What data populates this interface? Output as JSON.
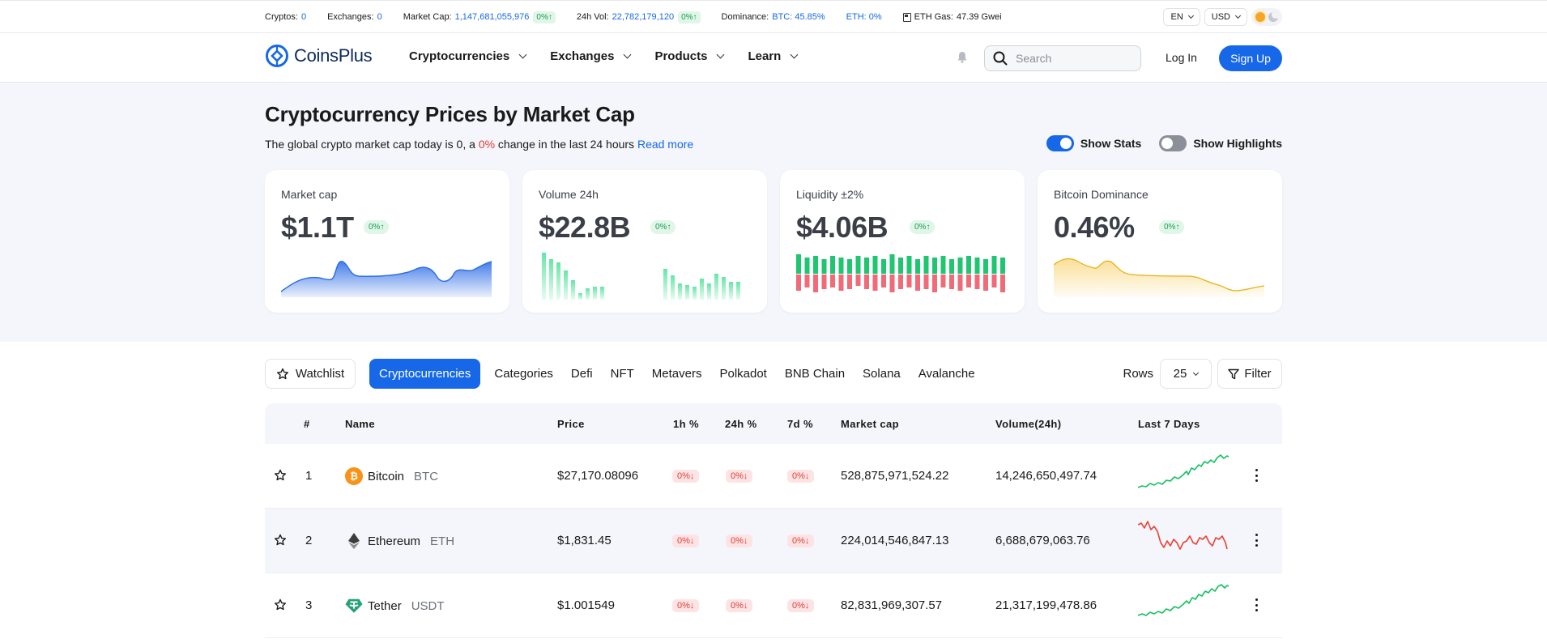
{
  "ticker": {
    "cryptos_label": "Cryptos:",
    "cryptos_value": "0",
    "exchanges_label": "Exchanges:",
    "exchanges_value": "0",
    "marketcap_label": "Market Cap:",
    "marketcap_value": "1,147,681,055,976",
    "marketcap_change": "0%",
    "vol_label": "24h Vol:",
    "vol_value": "22,782,179,120",
    "vol_change": "0%",
    "dominance_label": "Dominance:",
    "dominance_btc": "BTC: 45.85%",
    "dominance_eth": "ETH: 0%",
    "gas_label": "ETH Gas:",
    "gas_value": "47.39 Gwei",
    "language": "EN",
    "currency": "USD"
  },
  "header": {
    "logo_text": "CoinsPlus",
    "nav": [
      "Cryptocurrencies",
      "Exchanges",
      "Products",
      "Learn"
    ],
    "search_placeholder": "Search",
    "login_label": "Log In",
    "signup_label": "Sign Up"
  },
  "hero": {
    "title": "Cryptocurrency Prices by Market Cap",
    "subtitle_pre": "The global crypto market cap today is 0,  a ",
    "subtitle_change": "0%",
    "subtitle_post": " change in the last 24 hours ",
    "read_more": "Read more",
    "show_stats_label": "Show Stats",
    "show_stats_on": true,
    "show_highlights_label": "Show Highlights",
    "show_highlights_on": false
  },
  "cards": [
    {
      "title": "Market cap",
      "value": "$1.1T",
      "change": "0%",
      "chart": "area",
      "color": "#2f6fe6"
    },
    {
      "title": "Volume 24h",
      "value": "$22.8B",
      "change": "0%",
      "chart": "bars",
      "color": "#4fe3a0"
    },
    {
      "title": "Liquidity ±2%",
      "value": "$4.06B",
      "change": "0%",
      "chart": "bidask",
      "color": "#1fc670"
    },
    {
      "title": "Bitcoin Dominance",
      "value": "0.46%",
      "change": "0%",
      "chart": "line-area",
      "color": "#f0b820"
    }
  ],
  "tabs": {
    "watchlist_label": "Watchlist",
    "items": [
      "Cryptocurrencies",
      "Categories",
      "Defi",
      "NFT",
      "Metavers",
      "Polkadot",
      "BNB Chain",
      "Solana",
      "Avalanche"
    ],
    "active_index": 0,
    "rows_label": "Rows",
    "rows_value": "25",
    "filter_label": "Filter"
  },
  "table": {
    "headers": [
      "#",
      "Name",
      "Price",
      "1h %",
      "24h %",
      "7d %",
      "Market cap",
      "Volume(24h)",
      "Last 7 Days"
    ],
    "rows": [
      {
        "rank": "1",
        "name": "Bitcoin",
        "symbol": "BTC",
        "price": "$27,170.08096",
        "h1": "0%",
        "h24": "0%",
        "d7": "0%",
        "marketcap": "528,875,971,524.22",
        "volume": "14,246,650,497.74",
        "trend": "up",
        "logo_color": "#f7931a"
      },
      {
        "rank": "2",
        "name": "Ethereum",
        "symbol": "ETH",
        "price": "$1,831.45",
        "h1": "0%",
        "h24": "0%",
        "d7": "0%",
        "marketcap": "224,014,546,847.13",
        "volume": "6,688,679,063.76",
        "trend": "down",
        "logo_color": "#3c3c3d"
      },
      {
        "rank": "3",
        "name": "Tether",
        "symbol": "USDT",
        "price": "$1.001549",
        "h1": "0%",
        "h24": "0%",
        "d7": "0%",
        "marketcap": "82,831,969,307.57",
        "volume": "21,317,199,478.86",
        "trend": "up",
        "logo_color": "#26a17b"
      }
    ]
  },
  "colors": {
    "accent": "#1668e8",
    "up": "#1f9b52",
    "down": "#e53935",
    "spark_up": "#16c060",
    "spark_down": "#ea4335"
  }
}
